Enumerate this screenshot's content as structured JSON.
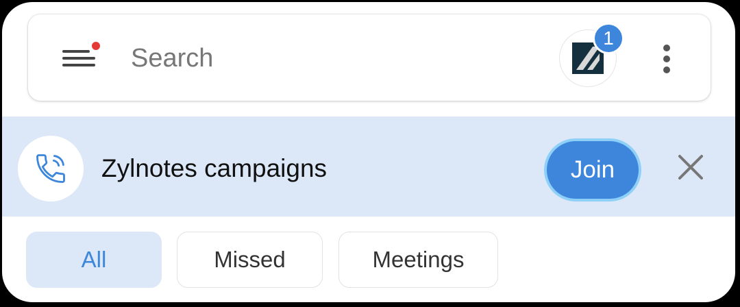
{
  "search": {
    "placeholder": "Search",
    "value": ""
  },
  "header": {
    "menu_icon": "hamburger-menu-icon",
    "menu_notification_color": "#e53935",
    "avatar_icon": "workspace-logo-icon",
    "badge_count": "1",
    "more_icon": "more-vertical-icon"
  },
  "banner": {
    "icon": "phone-call-icon",
    "title": "Zylnotes campaigns",
    "join_label": "Join",
    "close_icon": "close-icon",
    "background": "#dce8f7"
  },
  "tabs": [
    {
      "label": "All",
      "selected": true
    },
    {
      "label": "Missed",
      "selected": false
    },
    {
      "label": "Meetings",
      "selected": false
    }
  ],
  "colors": {
    "accent": "#3d86dc",
    "join_ring": "#8fd0f8"
  }
}
